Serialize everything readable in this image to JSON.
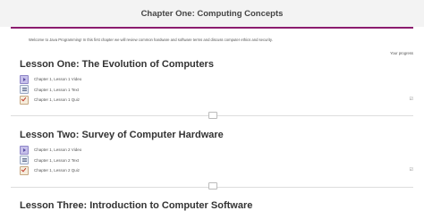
{
  "header": {
    "title": "Chapter One: Computing Concepts"
  },
  "intro": {
    "text": "Welcome to Java Programming! In this first chapter we will review common hardware and software terms and discuss computer ethics and security."
  },
  "progress": {
    "label": "Your progress"
  },
  "lessons": [
    {
      "title": "Lesson One: The Evolution of Computers",
      "items": [
        {
          "icon": "video-icon",
          "label": "Chapter 1, Lesson 1 Video",
          "completed": false
        },
        {
          "icon": "document-icon",
          "label": "Chapter 1, Lesson 1 Text",
          "completed": false
        },
        {
          "icon": "quiz-icon",
          "label": "Chapter 1, Lesson 1 Quiz",
          "completed": true
        }
      ]
    },
    {
      "title": "Lesson Two: Survey of Computer Hardware",
      "items": [
        {
          "icon": "video-icon",
          "label": "Chapter 1, Lesson 2 Video",
          "completed": false
        },
        {
          "icon": "document-icon",
          "label": "Chapter 1, Lesson 2 Text",
          "completed": false
        },
        {
          "icon": "quiz-icon",
          "label": "Chapter 1, Lesson 2 Quiz",
          "completed": true
        }
      ]
    },
    {
      "title": "Lesson Three: Introduction to Computer Software",
      "items": []
    }
  ],
  "colors": {
    "accent": "#8b1c6e",
    "header_bg": "#f3f3f3"
  }
}
